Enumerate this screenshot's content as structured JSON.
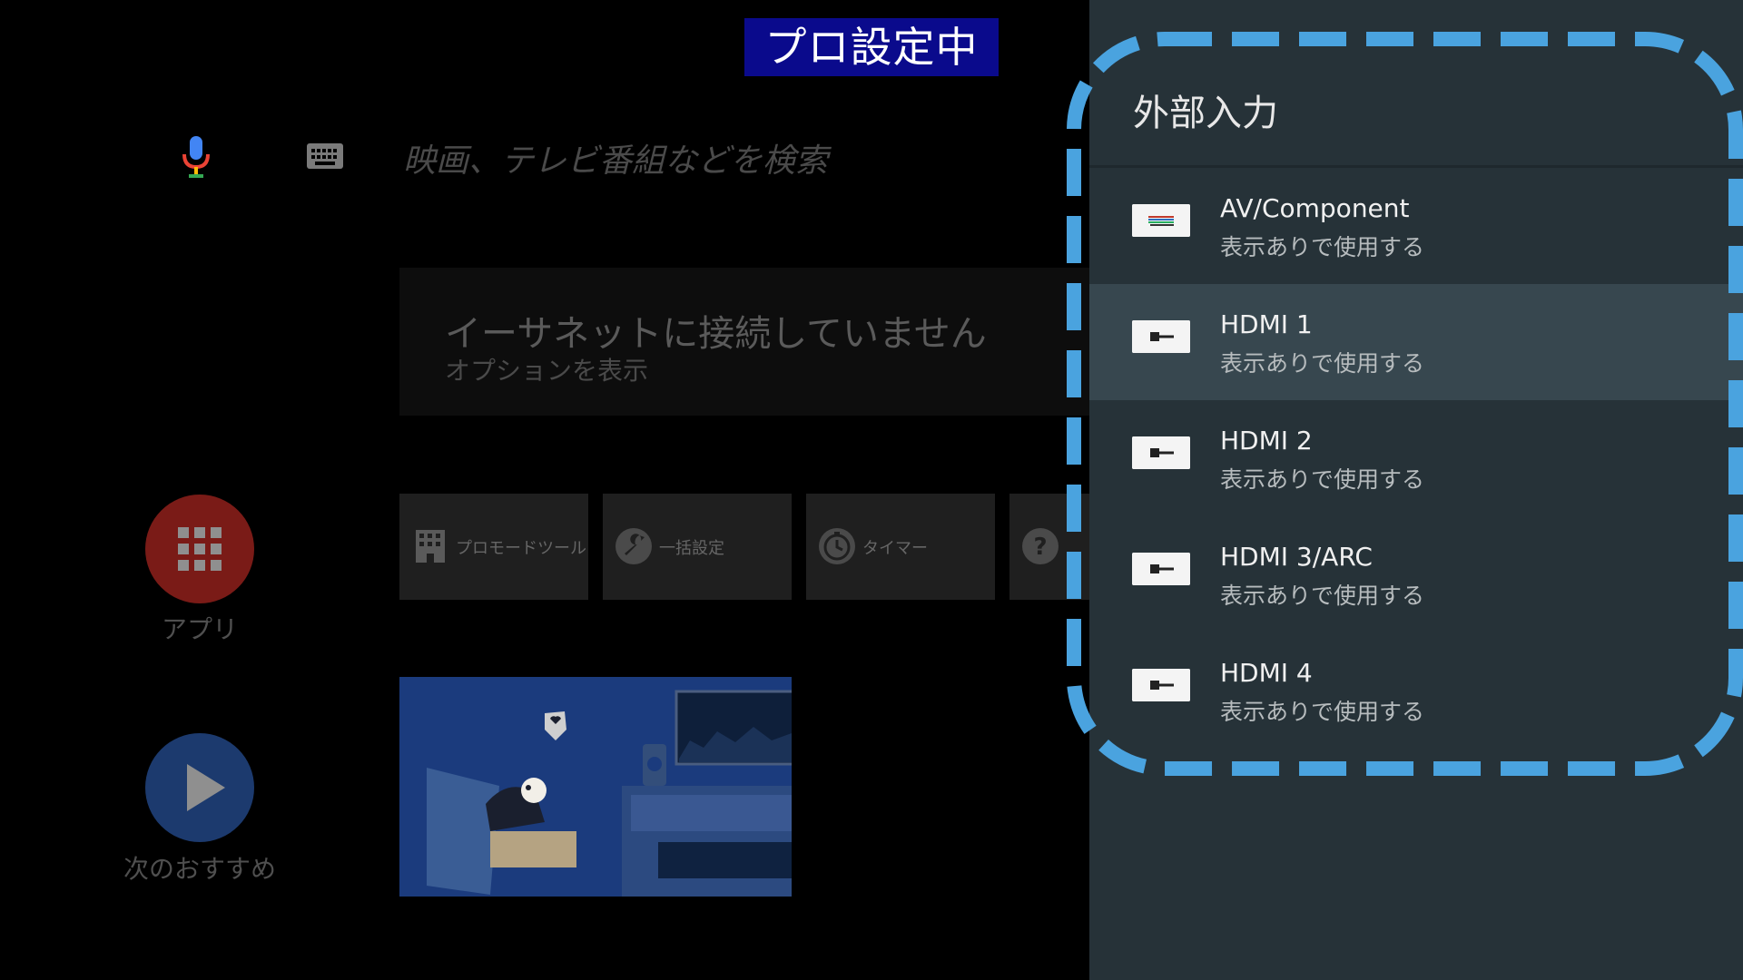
{
  "banner": {
    "text": "プロ設定中",
    "bg": "#0a0a8c"
  },
  "search": {
    "placeholder": "映画、テレビ番組などを検索",
    "mic_icon": "mic-icon",
    "keyboard_icon": "keyboard-icon"
  },
  "ethernet_card": {
    "title": "イーサネットに接続していません",
    "subtitle": "オプションを表示"
  },
  "side_buttons": {
    "apps": {
      "label": "アプリ",
      "icon": "apps-grid-icon",
      "color": "#7a1b17"
    },
    "next": {
      "label": "次のおすすめ",
      "icon": "play-icon",
      "color": "#1c3a6e"
    }
  },
  "tiles": [
    {
      "label": "プロモードツール",
      "icon": "building-icon"
    },
    {
      "label": "一括設定",
      "icon": "wrench-icon"
    },
    {
      "label": "タイマー",
      "icon": "timer-icon"
    },
    {
      "label": "",
      "icon": "help-icon"
    }
  ],
  "panel": {
    "title": "外部入力",
    "bg": "#263238",
    "selected_bg": "#37474f",
    "highlight_color": "#4aa3df",
    "items": [
      {
        "name": "AV/Component",
        "status": "表示ありで使用する",
        "icon": "av-component-icon"
      },
      {
        "name": "HDMI 1",
        "status": "表示ありで使用する",
        "icon": "hdmi-icon"
      },
      {
        "name": "HDMI 2",
        "status": "表示ありで使用する",
        "icon": "hdmi-icon"
      },
      {
        "name": "HDMI 3/ARC",
        "status": "表示ありで使用する",
        "icon": "hdmi-icon"
      },
      {
        "name": "HDMI 4",
        "status": "表示ありで使用する",
        "icon": "hdmi-icon"
      }
    ],
    "selected_index": 1
  }
}
